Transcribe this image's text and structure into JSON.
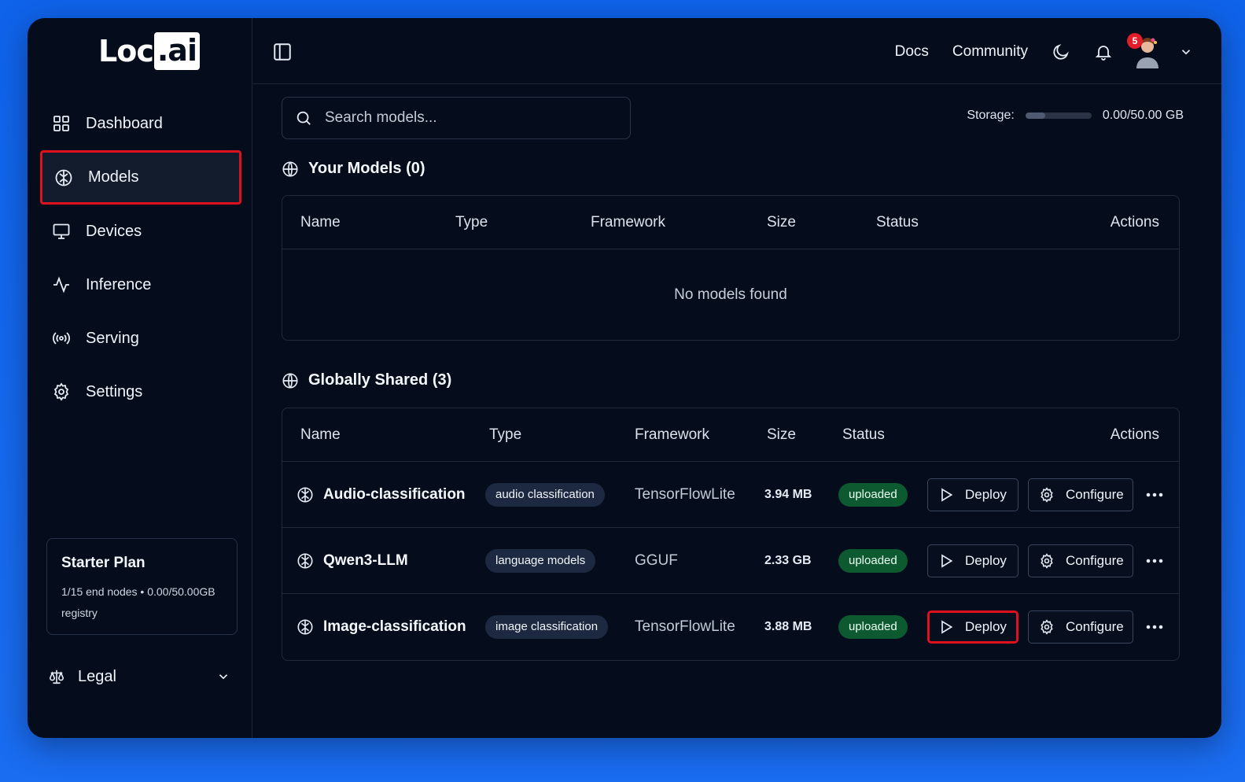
{
  "app": {
    "logo_main": "Loc",
    "logo_box": ".ai"
  },
  "sidebar": {
    "items": [
      {
        "label": "Dashboard",
        "icon": "grid-icon"
      },
      {
        "label": "Models",
        "icon": "brain-icon",
        "active": true
      },
      {
        "label": "Devices",
        "icon": "monitor-icon"
      },
      {
        "label": "Inference",
        "icon": "activity-icon"
      },
      {
        "label": "Serving",
        "icon": "broadcast-icon"
      },
      {
        "label": "Settings",
        "icon": "gear-icon"
      }
    ],
    "plan": {
      "title": "Starter Plan",
      "details": "1/15 end nodes • 0.00/50.00GB registry"
    },
    "legal": "Legal"
  },
  "topbar": {
    "docs": "Docs",
    "community": "Community",
    "notifications": "5"
  },
  "search": {
    "placeholder": "Search models..."
  },
  "storage": {
    "label": "Storage:",
    "value": "0.00/50.00 GB",
    "fill_fraction": 0.3
  },
  "your_models": {
    "title": "Your Models (0)",
    "columns": [
      "Name",
      "Type",
      "Framework",
      "Size",
      "Status",
      "Actions"
    ],
    "empty": "No models found"
  },
  "shared": {
    "title": "Globally Shared (3)",
    "columns": [
      "Name",
      "Type",
      "Framework",
      "Size",
      "Status",
      "Actions"
    ],
    "rows": [
      {
        "name": "Audio-classification",
        "type": "audio classification",
        "framework": "TensorFlowLite",
        "size": "3.94 MB",
        "status": "uploaded"
      },
      {
        "name": "Qwen3-LLM",
        "type": "language models",
        "framework": "GGUF",
        "size": "2.33 GB",
        "status": "uploaded"
      },
      {
        "name": "Image-classification",
        "type": "image classification",
        "framework": "TensorFlowLite",
        "size": "3.88 MB",
        "status": "uploaded"
      }
    ],
    "deploy_label": "Deploy",
    "configure_label": "Configure"
  },
  "colors": {
    "background": "#050d1c",
    "highlight": "#e0111e",
    "status_uploaded": "#0d5a30"
  }
}
